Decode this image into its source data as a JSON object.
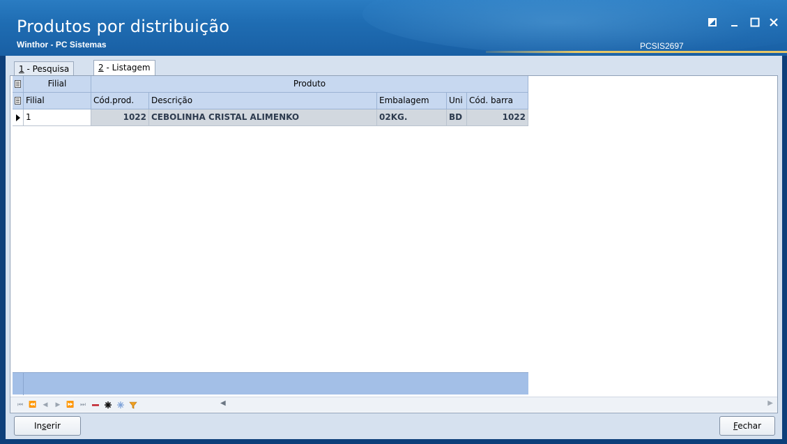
{
  "window": {
    "title": "Produtos por distribuição",
    "subtitle": "Winthor - PC Sistemas",
    "code": "PCSIS2697"
  },
  "tabs": [
    {
      "num": "1",
      "label": " - Pesquisa"
    },
    {
      "num": "2",
      "label": " - Listagem"
    }
  ],
  "grid": {
    "bands": {
      "filial": "Filial",
      "produto": "Produto"
    },
    "columns": {
      "filial": "Filial",
      "codprod": "Cód.prod.",
      "descricao": "Descrição",
      "embalagem": "Embalagem",
      "unidade": "Uni",
      "codbarra": "Cód. barra"
    },
    "rows": [
      {
        "filial": "1",
        "codprod": "1022",
        "descricao": "CEBOLINHA CRISTAL ALIMENKO",
        "embalagem": "02KG.",
        "unidade": "BD",
        "codbarra": "1022"
      }
    ]
  },
  "buttons": {
    "inserir_pre": "In",
    "inserir_mn": "s",
    "inserir_post": "erir",
    "fechar_mn": "F",
    "fechar_post": "echar"
  },
  "icons": {
    "navigator": [
      "first-icon",
      "prev-page-icon",
      "prev-icon",
      "next-icon",
      "next-page-icon",
      "last-icon",
      "delete-icon",
      "insert-icon",
      "refresh-icon",
      "filter-icon"
    ]
  }
}
